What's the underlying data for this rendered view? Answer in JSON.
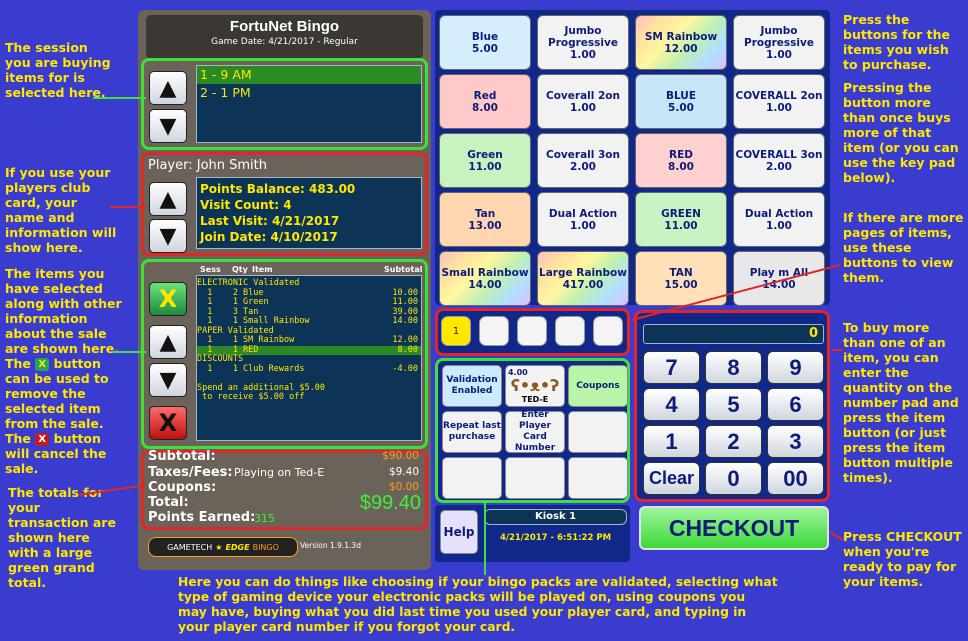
{
  "pos": {
    "title": "FortuNet Bingo",
    "game_date": "Game Date: 4/21/2017 - Regular",
    "sessions": [
      "1 - 9 AM",
      "2 - 1 PM"
    ],
    "player": {
      "name": "Player: John Smith",
      "lines": [
        "Points Balance: 483.00",
        "Visit Count: 4",
        "Last Visit: 4/21/2017",
        "Join Date: 4/10/2017"
      ]
    },
    "items_header": {
      "sess": "Sess",
      "qty": "Qty",
      "item": "Item",
      "subtotal": "Subtotal"
    },
    "items": [
      {
        "text": "ELECTRONIC Validated",
        "sub": ""
      },
      {
        "text": "  1    2 Blue",
        "sub": "10.00"
      },
      {
        "text": "  1    1 Green",
        "sub": "11.00"
      },
      {
        "text": "  1    3 Tan",
        "sub": "39.00"
      },
      {
        "text": "  1    1 Small Rainbow",
        "sub": "14.00"
      },
      {
        "text": "PAPER Validated",
        "sub": ""
      },
      {
        "text": "  1    1 SM Rainbow",
        "sub": "12.00"
      },
      {
        "text": "  1    1 RED",
        "sub": "8.00"
      },
      {
        "text": "DISCOUNTS",
        "sub": ""
      },
      {
        "text": "  1    1 Club Rewards",
        "sub": "-4.00"
      },
      {
        "text": "",
        "sub": ""
      },
      {
        "text": "Spend an additional $5.00",
        "sub": ""
      },
      {
        "text": " to receive $5.00 off",
        "sub": ""
      }
    ],
    "remove_label": "X",
    "cancel_label": "X",
    "totals": {
      "subtotal_label": "Subtotal:",
      "subtotal_value": "$90.00",
      "taxes_label": "Taxes/Fees:",
      "taxes_note": "Playing on Ted-E",
      "taxes_value": "$9.40",
      "coupons_label": "Coupons:",
      "coupons_value": "$0.00",
      "total_label": "Total:",
      "total_value": "$99.40",
      "points_label": "Points Earned:",
      "points_value": "315"
    },
    "logo": {
      "a": "GAMETECH",
      "b": "EDGE",
      "c": "BINGO"
    },
    "version": "Version  1.9.1.3d"
  },
  "products": [
    {
      "name": "Blue",
      "price": "5.00",
      "bg": "#d4eefc"
    },
    {
      "name": "Jumbo Progressive",
      "price": "1.00",
      "bg": "#f2f2f2"
    },
    {
      "name": "SM Rainbow",
      "price": "12.00",
      "bg": "rainbow"
    },
    {
      "name": "Jumbo Progressive",
      "price": "1.00",
      "bg": "#f2f2f2"
    },
    {
      "name": "Red",
      "price": "8.00",
      "bg": "#ffc9c9"
    },
    {
      "name": "Coverall 2on",
      "price": "1.00",
      "bg": "#f2f2f2"
    },
    {
      "name": "BLUE",
      "price": "5.00",
      "bg": "#c9e6f9"
    },
    {
      "name": "COVERALL 2on",
      "price": "1.00",
      "bg": "#f2f2f2"
    },
    {
      "name": "Green",
      "price": "11.00",
      "bg": "#c8f3c0"
    },
    {
      "name": "Coverall 3on",
      "price": "2.00",
      "bg": "#f2f2f2"
    },
    {
      "name": "RED",
      "price": "8.00",
      "bg": "#ffd0d0"
    },
    {
      "name": "COVERALL 3on",
      "price": "2.00",
      "bg": "#f2f2f2"
    },
    {
      "name": "Tan",
      "price": "13.00",
      "bg": "#ffd6b0"
    },
    {
      "name": "Dual Action",
      "price": "1.00",
      "bg": "#f2f2f2"
    },
    {
      "name": "GREEN",
      "price": "11.00",
      "bg": "#c9f3c2"
    },
    {
      "name": "Dual Action",
      "price": "1.00",
      "bg": "#f2f2f2"
    },
    {
      "name": "Small Rainbow",
      "price": "14.00",
      "bg": "rainbow"
    },
    {
      "name": "Large Rainbow",
      "price": "417.00",
      "bg": "rainbow"
    },
    {
      "name": "TAN",
      "price": "15.00",
      "bg": "#ffe0b8"
    },
    {
      "name": "Play m All",
      "price": "14.00",
      "bg": "#e8e8e8"
    }
  ],
  "page_buttons": [
    "1",
    "",
    "",
    "",
    ""
  ],
  "options": {
    "validation": "Validation Enabled",
    "tede_label": "TED-E",
    "tede_value": "4.00",
    "coupons": "Coupons",
    "repeat": "Repeat last purchase",
    "enter_card": "Enter Player Card Number"
  },
  "help": "Help",
  "kiosk": "Kiosk 1",
  "datetime": "4/21/2017 - 6:51:22 PM",
  "keypad": {
    "display": "0",
    "keys": [
      "7",
      "8",
      "9",
      "4",
      "5",
      "6",
      "1",
      "2",
      "3",
      "Clear",
      "0",
      "00"
    ]
  },
  "checkout": "CHECKOUT",
  "annotations": {
    "session": "The session you are buying items for is selected here.",
    "player": "If you use your players club card, your name and information will show here.",
    "items_a": "The items you have selected along with other information about the sale are shown here.  The",
    "items_b": "button can be used to remove the selected item from the sale.",
    "items_c_pre": "The",
    "items_c_post": "button will cancel the sale.",
    "totals": "The totals for your transaction are shown here with a large green grand total.",
    "buttons": "Press the buttons for the items you wish to purchase.",
    "multi": "Pressing the button more than once buys more of that item (or you can use the key pad below).",
    "pages": "If there are more pages of items, use these buttons to view them.",
    "keypad": "To buy more than one of an item, you can enter the quantity on the number pad and press the item button (or just press the item button multiple times).",
    "checkout": "Press CHECKOUT when you're ready to pay for your items.",
    "bottom": "Here you can do things like choosing if your bingo packs are validated, selecting what type of gaming device your electronic packs will be played on, using coupons you may have, buying what you did last time you used your player card, and typing in your player card number if you forgot your card."
  }
}
